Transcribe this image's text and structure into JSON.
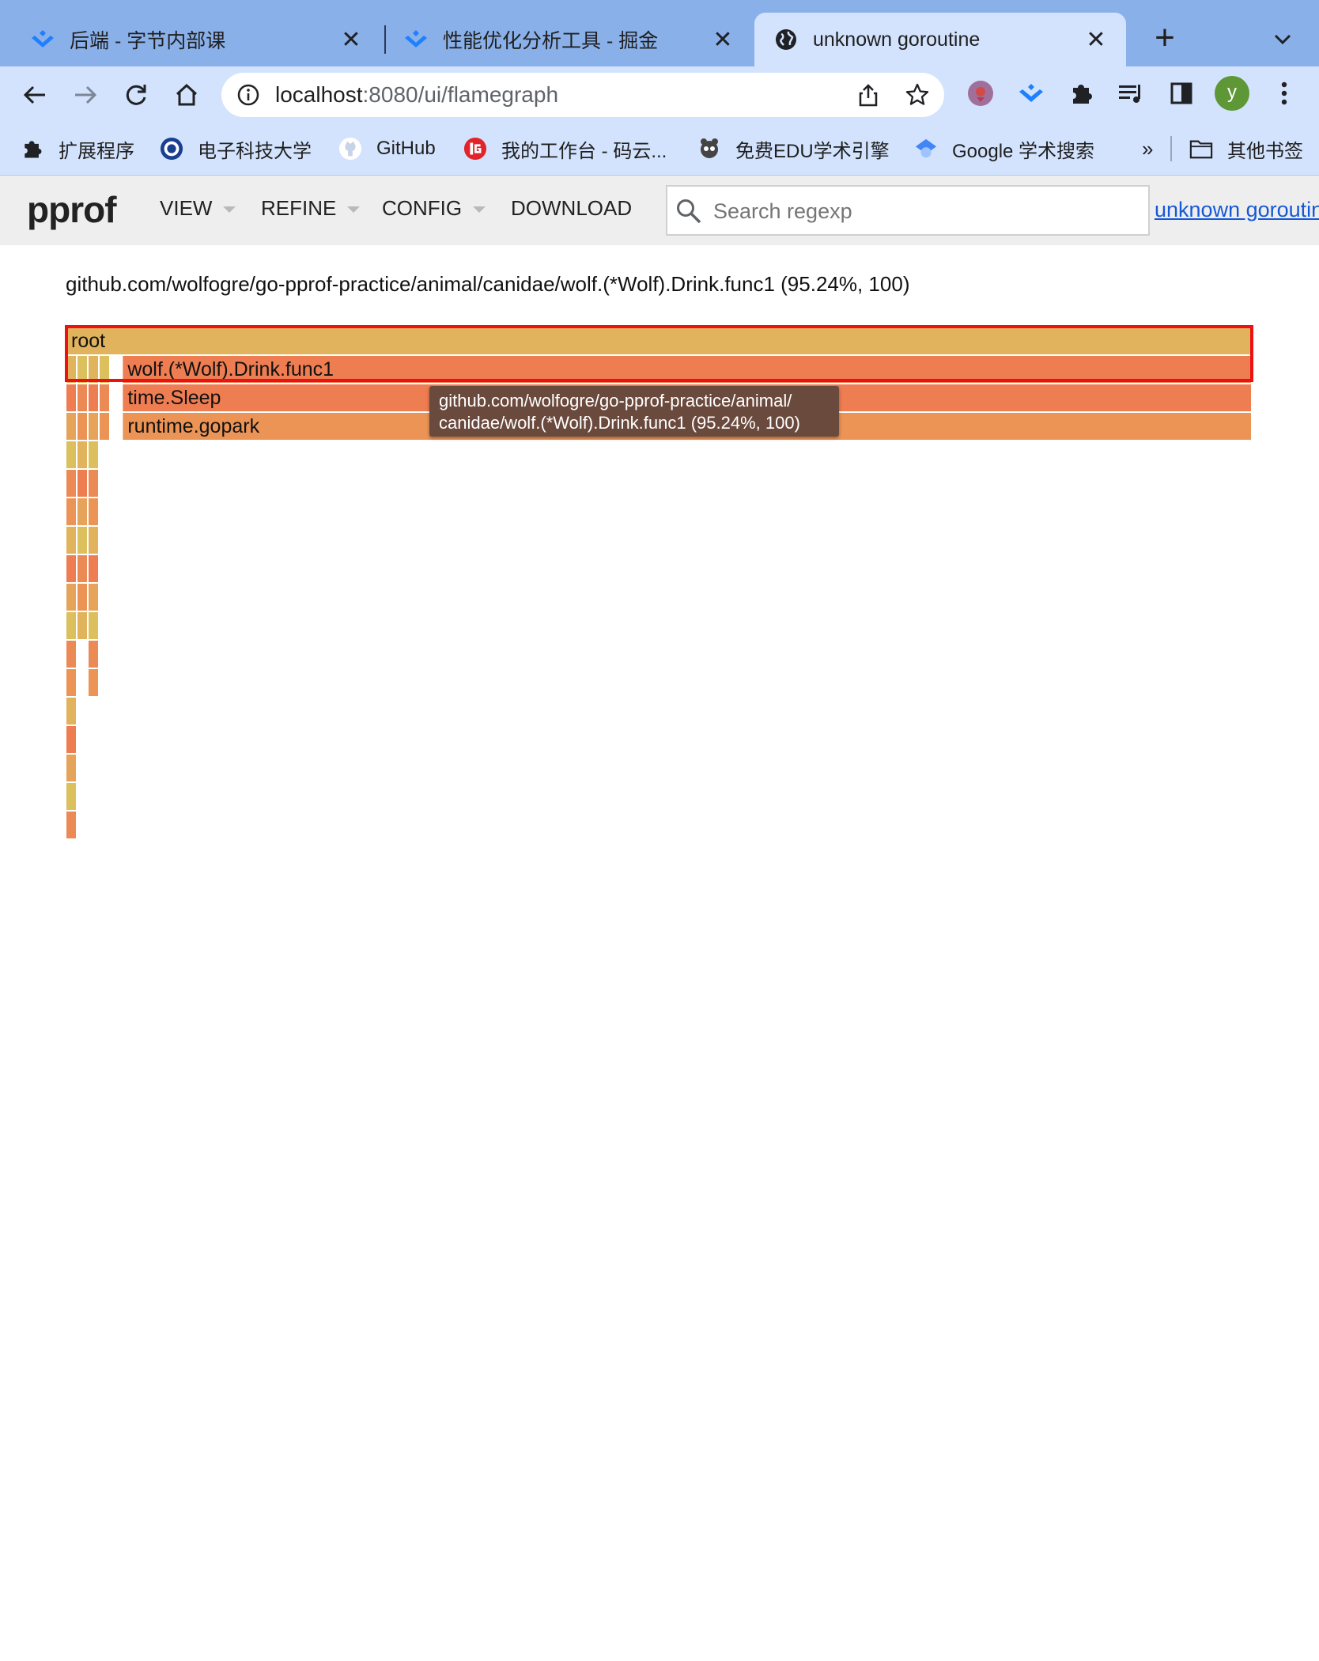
{
  "browser": {
    "tabs": [
      {
        "title": "后端 - 字节内部课",
        "icon": "juejin-icon",
        "active": false
      },
      {
        "title": "性能优化分析工具 - 掘金",
        "icon": "juejin-icon",
        "active": false
      },
      {
        "title": "unknown goroutine",
        "icon": "globe-icon",
        "active": true
      }
    ],
    "new_tab_label": "+",
    "address": {
      "host": "localhost",
      "path": ":8080/ui/flamegraph"
    },
    "bookmarks": [
      {
        "label": "扩展程序",
        "icon": "puzzle-icon"
      },
      {
        "label": "电子科技大学",
        "icon": "uestc-icon"
      },
      {
        "label": "GitHub",
        "icon": "github-icon"
      },
      {
        "label": "我的工作台 - 码云...",
        "icon": "gitee-icon"
      },
      {
        "label": "免费EDU学术引擎",
        "icon": "edu-icon"
      },
      {
        "label": "Google 学术搜索",
        "icon": "scholar-icon"
      }
    ],
    "bookmarks_overflow": "»",
    "other_bookmarks": "其他书签",
    "profile_initial": "y"
  },
  "pprof": {
    "logo": "pprof",
    "menu": [
      "VIEW",
      "REFINE",
      "CONFIG",
      "DOWNLOAD"
    ],
    "search_placeholder": "Search regexp",
    "profile_link": "unknown goroutine"
  },
  "flamegraph": {
    "current_frame": "github.com/wolfogre/go-pprof-practice/animal/canidae/wolf.(*Wolf).Drink.func1 (95.24%, 100)",
    "frames": [
      {
        "label": "root",
        "percent": 100,
        "color": "#e0b35c"
      },
      {
        "label": "wolf.(*Wolf).Drink.func1",
        "percent": 95.24,
        "color": "#ee7d52"
      },
      {
        "label": "time.Sleep",
        "percent": 95.24,
        "color": "#ee7d52"
      },
      {
        "label": "runtime.gopark",
        "percent": 95.24,
        "color": "#ec9456"
      }
    ],
    "tooltip": [
      "github.com/wolfogre/go-pprof-practice/animal/",
      "canidae/wolf.(*Wolf).Drink.func1 (95.24%, 100)"
    ],
    "highlight_color": "#ee1111"
  }
}
